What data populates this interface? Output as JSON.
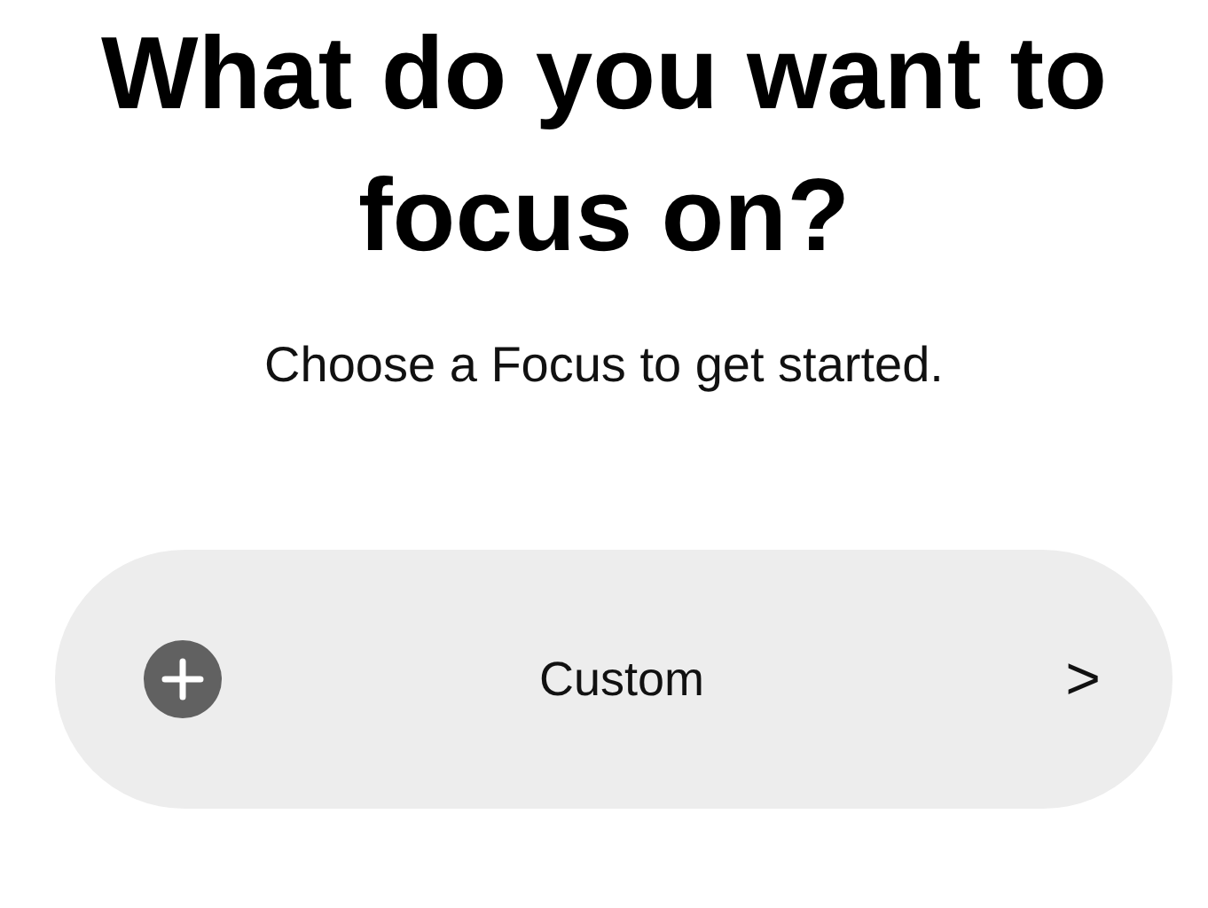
{
  "title": "What do you want to focus on?",
  "subtitle": "Choose a Focus to get started.",
  "options": [
    {
      "kind": "add",
      "label": "Custom",
      "action": ">"
    }
  ]
}
